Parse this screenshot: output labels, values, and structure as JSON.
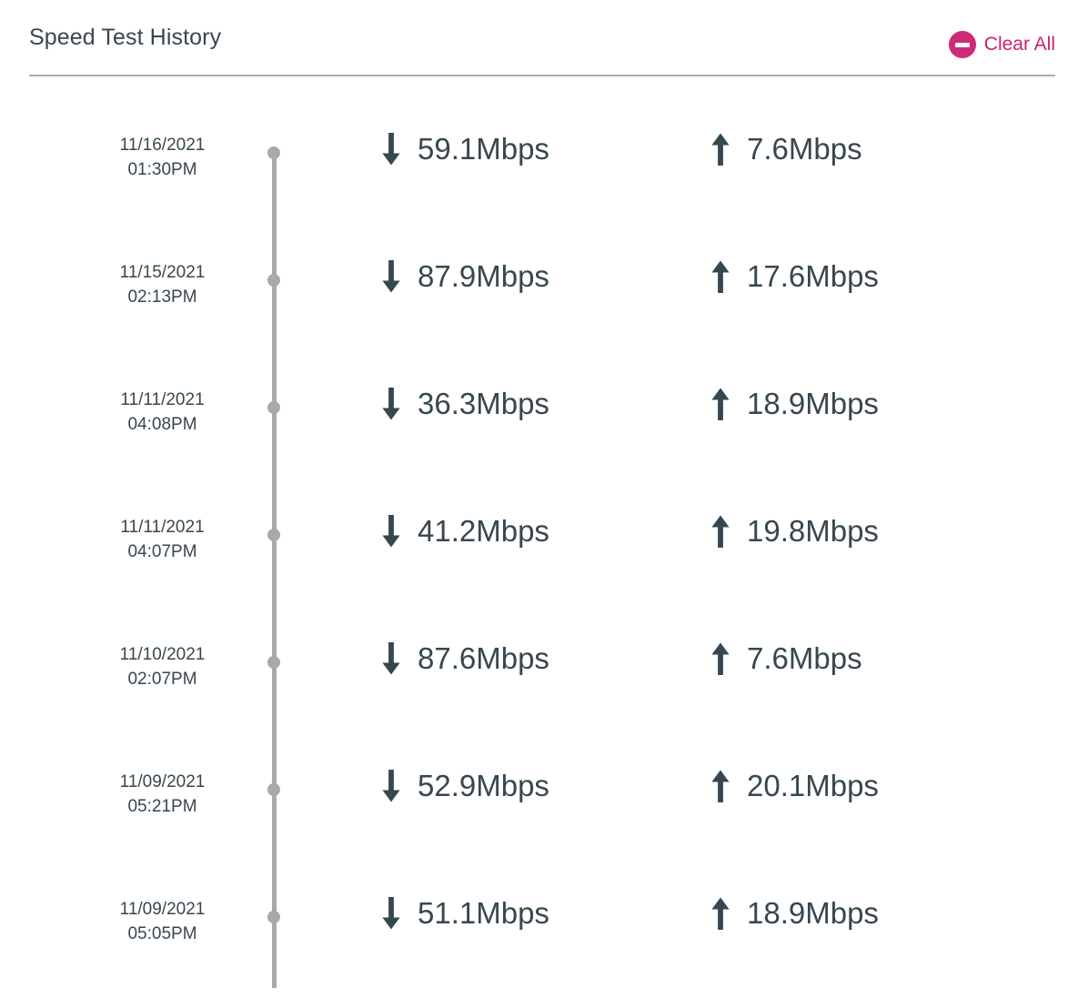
{
  "header": {
    "title": "Speed Test History",
    "clear_all_label": "Clear All",
    "clear_all_icon": "minus-circle-icon",
    "accent_color": "#cd1f6d",
    "icon_color": "#cd2a77",
    "divider_color": "#a9aeb3"
  },
  "timeline": {
    "line_color": "#a6aaae",
    "dot_color": "#a6aaae",
    "download_icon": "arrow-down-icon",
    "upload_icon": "arrow-up-icon",
    "text_color": "#37474f"
  },
  "entries": [
    {
      "date": "11/16/2021",
      "time": "01:30PM",
      "download": "59.1Mbps",
      "upload": "7.6Mbps"
    },
    {
      "date": "11/15/2021",
      "time": "02:13PM",
      "download": "87.9Mbps",
      "upload": "17.6Mbps"
    },
    {
      "date": "11/11/2021",
      "time": "04:08PM",
      "download": "36.3Mbps",
      "upload": "18.9Mbps"
    },
    {
      "date": "11/11/2021",
      "time": "04:07PM",
      "download": "41.2Mbps",
      "upload": "19.8Mbps"
    },
    {
      "date": "11/10/2021",
      "time": "02:07PM",
      "download": "87.6Mbps",
      "upload": "7.6Mbps"
    },
    {
      "date": "11/09/2021",
      "time": "05:21PM",
      "download": "52.9Mbps",
      "upload": "20.1Mbps"
    },
    {
      "date": "11/09/2021",
      "time": "05:05PM",
      "download": "51.1Mbps",
      "upload": "18.9Mbps"
    }
  ]
}
